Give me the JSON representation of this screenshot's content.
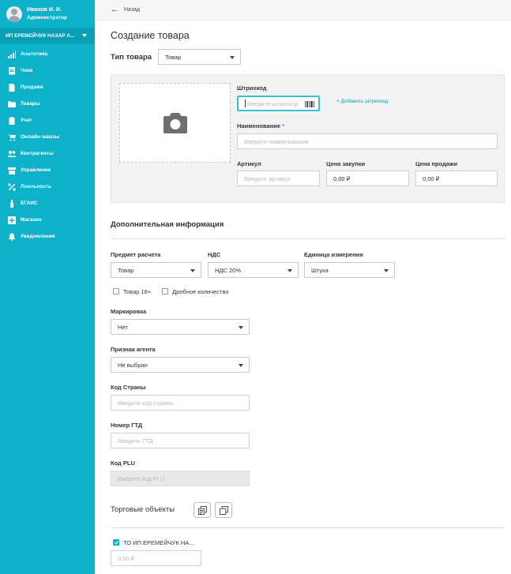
{
  "user": {
    "name": "Иванов И. И.",
    "role": "Администратор"
  },
  "company": "ИП ЕРЕМЕЙЧУК НАЗАР А...",
  "menu": [
    {
      "label": "Аналитика",
      "icon": "analytics-icon"
    },
    {
      "label": "Чеки",
      "icon": "receipt-icon"
    },
    {
      "label": "Продажи",
      "icon": "document-icon"
    },
    {
      "label": "Товары",
      "icon": "folder-icon"
    },
    {
      "label": "Учет",
      "icon": "clipboard-icon"
    },
    {
      "label": "Онлайн-заказы",
      "icon": "cart-icon"
    },
    {
      "label": "Контрагенты",
      "icon": "people-icon"
    },
    {
      "label": "Управление",
      "icon": "store-icon"
    },
    {
      "label": "Лояльность",
      "icon": "percent-icon"
    },
    {
      "label": "ЕГАИС",
      "icon": "bottle-icon"
    },
    {
      "label": "Магазин",
      "icon": "shop-plus-icon"
    },
    {
      "label": "Уведомления",
      "icon": "bell-icon"
    }
  ],
  "topbar": {
    "back_label": "Назад"
  },
  "page": {
    "title": "Создание товара"
  },
  "product_type": {
    "label": "Тип товара",
    "value": "Товар"
  },
  "barcode": {
    "label": "Штрихкод",
    "placeholder": "Введите штрихкод",
    "add_label": "+  Добавить штрихкод"
  },
  "name_field": {
    "label": "Наименование",
    "required_mark": "*",
    "placeholder": "Введите наименование"
  },
  "article": {
    "label": "Артикул",
    "placeholder": "Введите артикул"
  },
  "purchase_price": {
    "label": "Цена закупки",
    "value": "0,00 ₽"
  },
  "sale_price": {
    "label": "Цена продажи",
    "value": "0,00 ₽"
  },
  "additional": {
    "title": "Дополнительная информация",
    "subject": {
      "label": "Предмет расчета",
      "value": "Товар"
    },
    "vat": {
      "label": "НДС",
      "value": "НДС 20%"
    },
    "unit": {
      "label": "Единица измерения",
      "value": "Штука"
    },
    "adult": {
      "label": "Товар 18+",
      "checked": false
    },
    "fractional": {
      "label": "Дробное количество",
      "checked": false
    },
    "marking": {
      "label": "Маркировка",
      "value": "Нет"
    },
    "agent": {
      "label": "Признак агента",
      "value": "Не выбран"
    },
    "country": {
      "label": "Код Страны",
      "placeholder": "Введите код страны"
    },
    "gtd": {
      "label": "Номер ГТД",
      "placeholder": "Введите ГТД"
    },
    "plu": {
      "label": "Код PLU",
      "placeholder": "Введите код PLU"
    }
  },
  "trade_objects": {
    "title": "Торговые объекты",
    "item_label": "ТО ИП ЕРЕМЕЙЧУК НА...",
    "item_checked": true,
    "price_placeholder": "0,00 ₽"
  },
  "colors": {
    "sidebar": "#0db2c8",
    "accent": "#0a9fb4"
  }
}
